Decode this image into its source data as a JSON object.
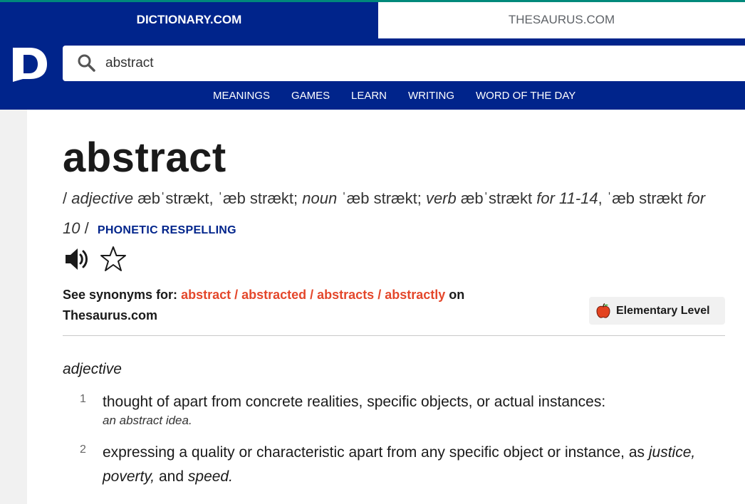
{
  "tabs": {
    "dictionary": "DICTIONARY.COM",
    "thesaurus": "THESAURUS.COM"
  },
  "search": {
    "value": "abstract"
  },
  "nav": {
    "meanings": "MEANINGS",
    "games": "GAMES",
    "learn": "LEARN",
    "writing": "WRITING",
    "wotd": "WORD OF THE DAY"
  },
  "entry": {
    "word": "abstract",
    "pron": {
      "slash_open": "/",
      "pos1": "adjective",
      "p1": "æbˈstrækt, ˈæb strækt;",
      "pos2": "noun",
      "p2": "ˈæb strækt;",
      "pos3": "verb",
      "p3": "æbˈstrækt",
      "range1": "for 11-14",
      "p4": ", ˈæb strækt",
      "range2": "for 10",
      "slash_close": "/",
      "phonetic_link": "PHONETIC RESPELLING"
    },
    "synonyms": {
      "prefix": "See synonyms for:",
      "links": "abstract / abstracted / abstracts / abstractly",
      "suffix": "on",
      "site": "Thesaurus.com"
    },
    "level": "Elementary Level",
    "pos_heading": "adjective",
    "definitions": [
      {
        "num": "1",
        "text": "thought of apart from concrete realities, specific objects, or actual instances:",
        "example": "an abstract idea."
      },
      {
        "num": "2",
        "text_a": "expressing a quality or characteristic apart from any specific object or instance, as",
        "ex_1": "justice, poverty,",
        "and": "and",
        "ex_2": "speed."
      }
    ]
  },
  "colors": {
    "brand": "#00248b",
    "accent": "#e4472b",
    "top_line": "#00897b"
  },
  "icons": {
    "logo": "dictionary-logo-icon",
    "search": "search-icon",
    "speaker": "speaker-icon",
    "star": "star-icon",
    "apple": "apple-icon"
  }
}
